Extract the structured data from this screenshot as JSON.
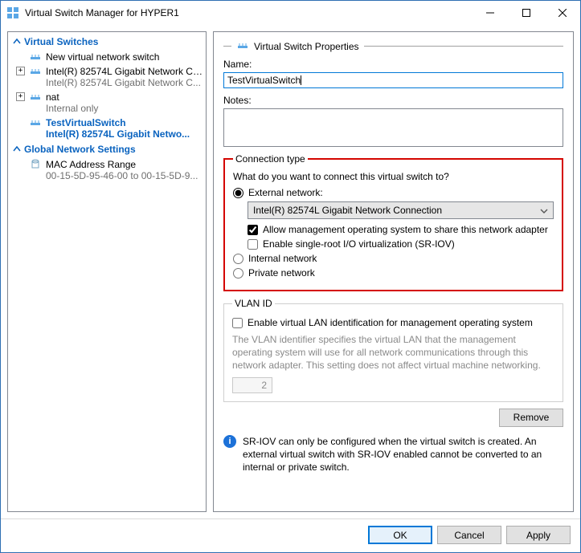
{
  "window": {
    "title": "Virtual Switch Manager for HYPER1"
  },
  "sidebar": {
    "section1": "Virtual Switches",
    "newSwitch": "New virtual network switch",
    "items": [
      {
        "label": "Intel(R) 82574L Gigabit Network Co...",
        "sub": "Intel(R) 82574L Gigabit Network C..."
      },
      {
        "label": "nat",
        "sub": "Internal only"
      },
      {
        "label": "TestVirtualSwitch",
        "sub": "Intel(R) 82574L Gigabit Netwo..."
      }
    ],
    "section2": "Global Network Settings",
    "mac": {
      "label": "MAC Address Range",
      "sub": "00-15-5D-95-46-00 to 00-15-5D-9..."
    }
  },
  "props": {
    "header": "Virtual Switch Properties",
    "nameLabel": "Name:",
    "nameValue": "TestVirtualSwitch",
    "notesLabel": "Notes:",
    "conn": {
      "legend": "Connection type",
      "question": "What do you want to connect this virtual switch to?",
      "external": "External network:",
      "adapter": "Intel(R) 82574L Gigabit Network Connection",
      "allowMgmt": "Allow management operating system to share this network adapter",
      "sriov": "Enable single-root I/O virtualization (SR-IOV)",
      "internal": "Internal network",
      "private": "Private network"
    },
    "vlan": {
      "legend": "VLAN ID",
      "enable": "Enable virtual LAN identification for management operating system",
      "help": "The VLAN identifier specifies the virtual LAN that the management operating system will use for all network communications through this network adapter. This setting does not affect virtual machine networking.",
      "value": "2"
    },
    "remove": "Remove",
    "infoNote": "SR-IOV can only be configured when the virtual switch is created. An external virtual switch with SR-IOV enabled cannot be converted to an internal or private switch."
  },
  "footer": {
    "ok": "OK",
    "cancel": "Cancel",
    "apply": "Apply"
  }
}
